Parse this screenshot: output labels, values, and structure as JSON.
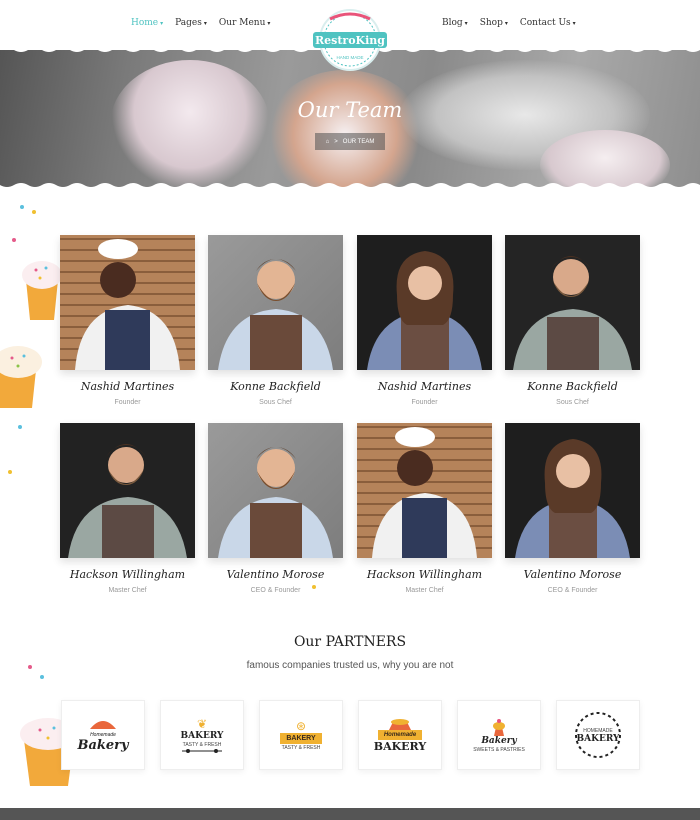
{
  "nav": {
    "left": [
      {
        "label": "Home",
        "active": true
      },
      {
        "label": "Pages",
        "active": false
      },
      {
        "label": "Our Menu",
        "active": false
      }
    ],
    "right": [
      {
        "label": "Blog",
        "active": false
      },
      {
        "label": "Shop",
        "active": false
      },
      {
        "label": "Contact Us",
        "active": false
      }
    ],
    "logo_text": "RestroKing",
    "logo_sub": "HAND MADE"
  },
  "hero": {
    "title": "Our Team",
    "breadcrumb_current": "OUR TEAM",
    "breadcrumb_sep": ">"
  },
  "team": [
    {
      "name": "Nashid Martines",
      "role": "Founder",
      "bg": "brick"
    },
    {
      "name": "Konne Backfield",
      "role": "Sous Chef",
      "bg": "grey"
    },
    {
      "name": "Nashid Martines",
      "role": "Founder",
      "bg": "dark"
    },
    {
      "name": "Konne Backfield",
      "role": "Sous Chef",
      "bg": "dark"
    },
    {
      "name": "Hackson Willingham",
      "role": "Master Chef",
      "bg": "dark"
    },
    {
      "name": "Valentino Morose",
      "role": "CEO & Founder",
      "bg": "grey"
    },
    {
      "name": "Hackson Willingham",
      "role": "Master Chef",
      "bg": "brick"
    },
    {
      "name": "Valentino Morose",
      "role": "CEO & Founder",
      "bg": "dark"
    }
  ],
  "partners": {
    "title": "Our PARTNERS",
    "subtitle": "famous companies trusted us, why you are not",
    "logos": [
      {
        "top": "Homemade",
        "main": "Bakery",
        "bottom": ""
      },
      {
        "top": "",
        "main": "BAKERY",
        "bottom": "TASTY & FRESH"
      },
      {
        "top": "",
        "main": "BAKERY",
        "bottom": "TASTY & FRESH"
      },
      {
        "top": "Homemade",
        "main": "BAKERY",
        "bottom": ""
      },
      {
        "top": "",
        "main": "Bakery",
        "bottom": "SWEETS & PASTRIES"
      },
      {
        "top": "HOMEMADE",
        "main": "BAKERY",
        "bottom": ""
      }
    ]
  },
  "colors": {
    "accent": "#4fc3c1",
    "logo_pink": "#e9547a",
    "ribbon": "#f0b131"
  }
}
